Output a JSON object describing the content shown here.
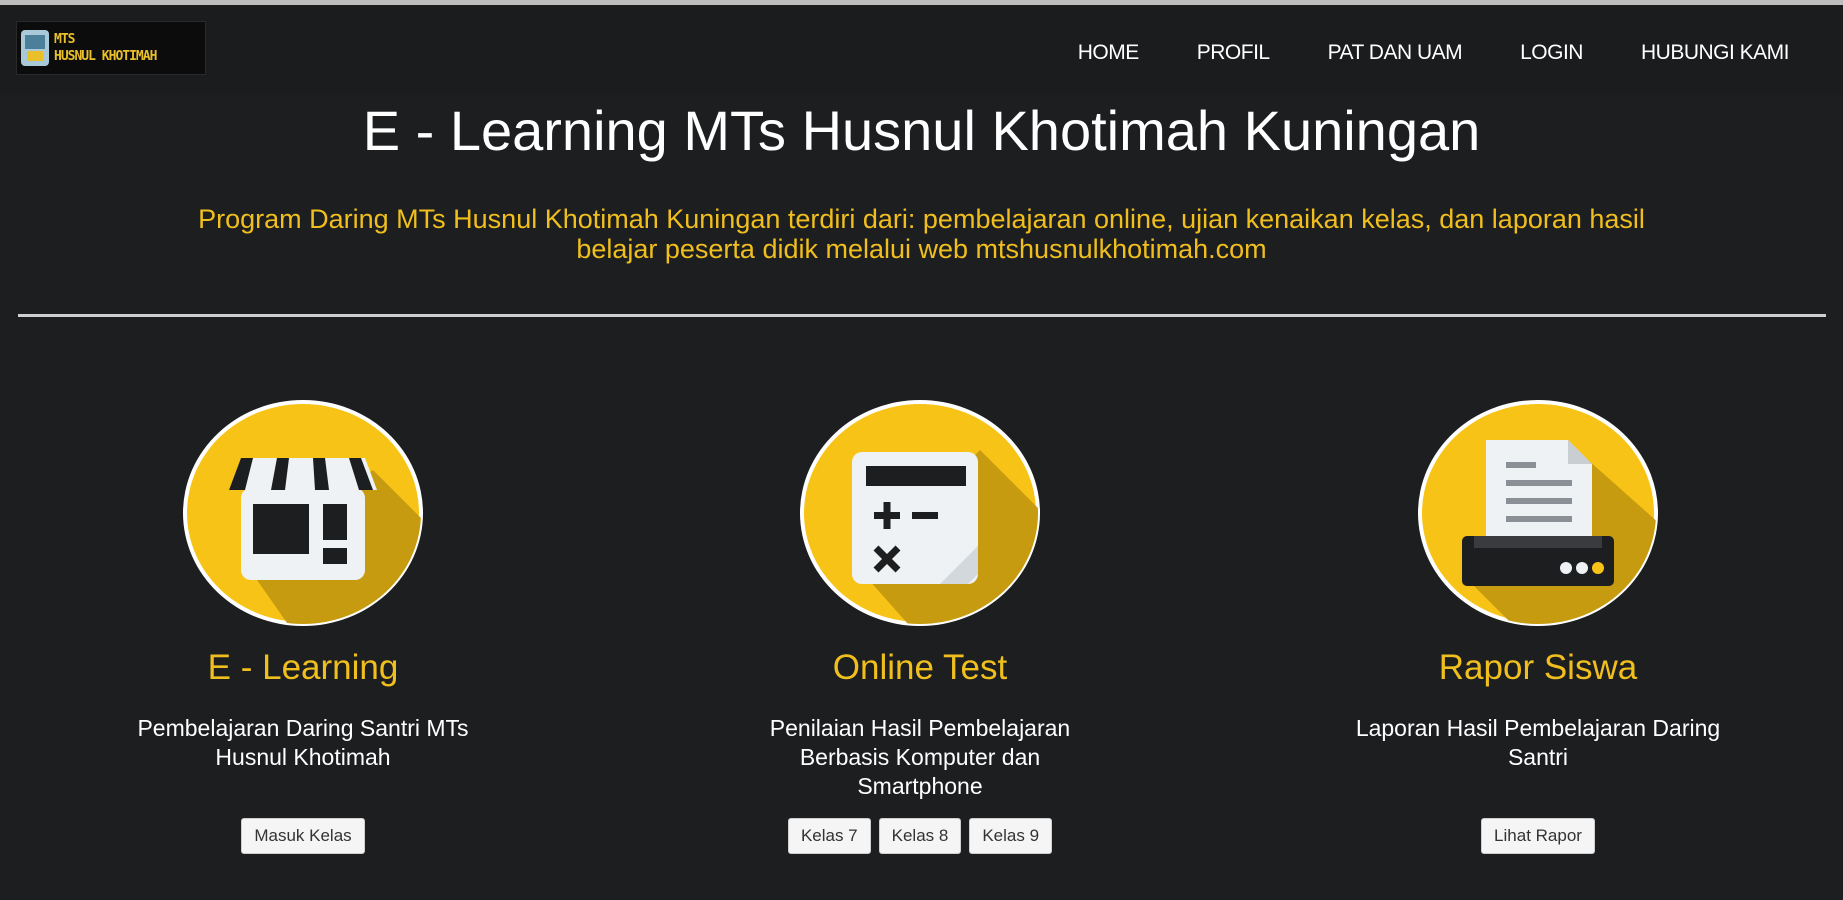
{
  "navbar": {
    "logo_line1": "MTS",
    "logo_line2": "HUSNUL KHOTIMAH",
    "links": [
      "HOME",
      "PROFIL",
      "PAT DAN UAM",
      "LOGIN",
      "HUBUNGI KAMI"
    ]
  },
  "header": {
    "title": "E - Learning MTs Husnul Khotimah Kuningan",
    "subtitle_line1": "Program Daring MTs Husnul Khotimah Kuningan terdiri dari: pembelajaran online, ujian kenaikan kelas, dan laporan hasil",
    "subtitle_line2": "belajar peserta didik melalui web mtshusnulkhotimah.com"
  },
  "cards": [
    {
      "icon": "storefront-icon",
      "title": "E - Learning",
      "desc_line1": "Pembelajaran Daring Santri MTs",
      "desc_line2": "Husnul Khotimah",
      "buttons": [
        "Masuk Kelas"
      ]
    },
    {
      "icon": "calculator-icon",
      "title": "Online Test",
      "desc_line1": "Penilaian Hasil Pembelajaran",
      "desc_line2": "Berbasis Komputer dan",
      "desc_line3": "Smartphone",
      "buttons": [
        "Kelas 7",
        "Kelas 8",
        "Kelas 9"
      ]
    },
    {
      "icon": "printer-icon",
      "title": "Rapor Siswa",
      "desc_line1": "Laporan Hasil Pembelajaran Daring",
      "desc_line2": "Santri",
      "buttons": [
        "Lihat Rapor"
      ]
    }
  ],
  "colors": {
    "background": "#1d1e20",
    "accent_yellow": "#f0bf1e",
    "icon_circle": "#f7c316",
    "icon_shadow": "#c79b10"
  }
}
